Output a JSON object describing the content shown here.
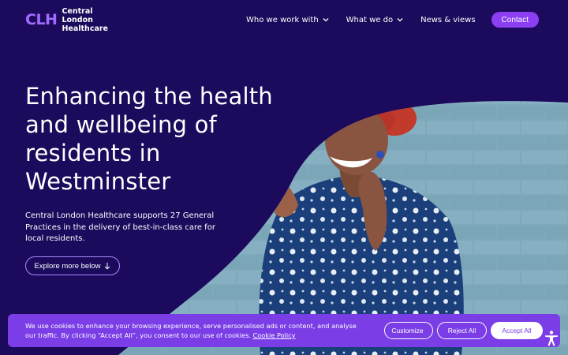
{
  "brand": {
    "mark": "CLH",
    "name_line1": "Central London",
    "name_line2": "Healthcare",
    "accent": "#8b3ef2",
    "background": "#1c0a5c"
  },
  "nav": {
    "items": [
      {
        "label": "Who we work with",
        "has_dropdown": true
      },
      {
        "label": "What we do",
        "has_dropdown": true
      },
      {
        "label": "News & views",
        "has_dropdown": false
      }
    ],
    "contact_label": "Contact"
  },
  "hero": {
    "headline": "Enhancing the health and wellbeing of residents in Westminster",
    "intro": "Central London Healthcare supports 27 General Practices in the delivery of best-in-class care for local residents.",
    "explore_label": "Explore more below"
  },
  "cookie_banner": {
    "text": "We use cookies to enhance your browsing experience, serve personalised ads or content, and analyse our traffic. By clicking “Accept All”, you consent to our use of cookies.",
    "policy_link": "Cookie Policy",
    "customize_label": "Customize",
    "reject_label": "Reject All",
    "accept_label": "Accept All",
    "color": "#7a3de6"
  },
  "icons": {
    "accessibility": "accessibility-icon",
    "chevron": "chevron-down-icon",
    "arrow": "arrow-down-icon"
  }
}
